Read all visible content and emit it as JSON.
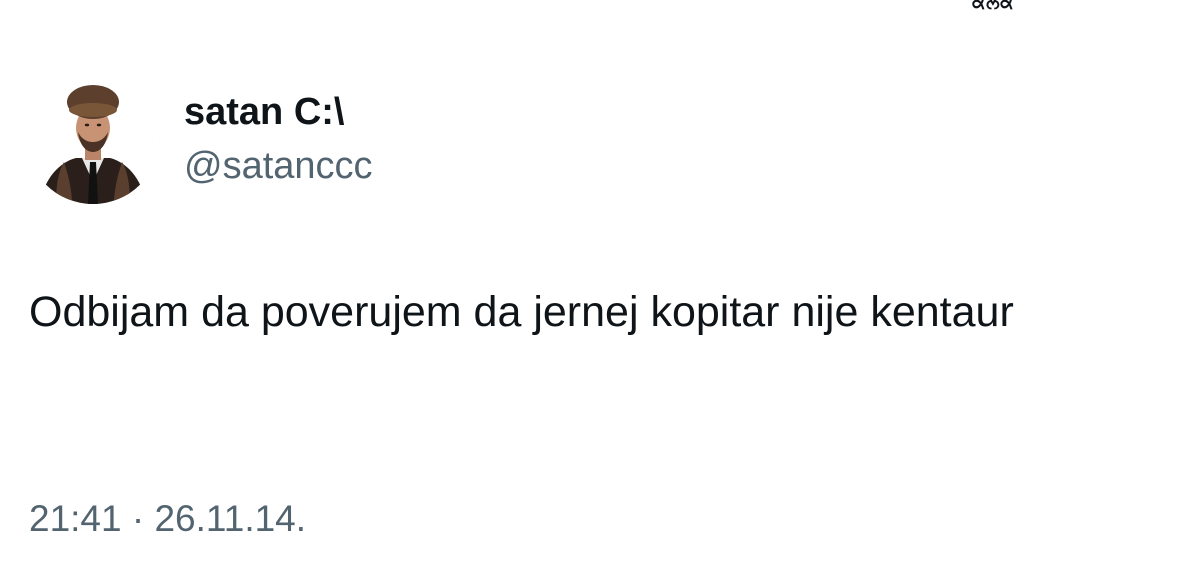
{
  "top_cut_text": "ਕਲਕ",
  "author": {
    "display_name": "satan C:\\",
    "handle": "@satanccc"
  },
  "tweet": {
    "text": "Odbijam da poverujem da jernej kopitar nije kentaur",
    "time": "21:41",
    "separator": "·",
    "date": "26.11.14."
  },
  "colors": {
    "text_primary": "#0f1419",
    "text_secondary": "#536471",
    "background": "#ffffff"
  },
  "icons": {
    "avatar": "profile-photo-man-fur-hat"
  }
}
